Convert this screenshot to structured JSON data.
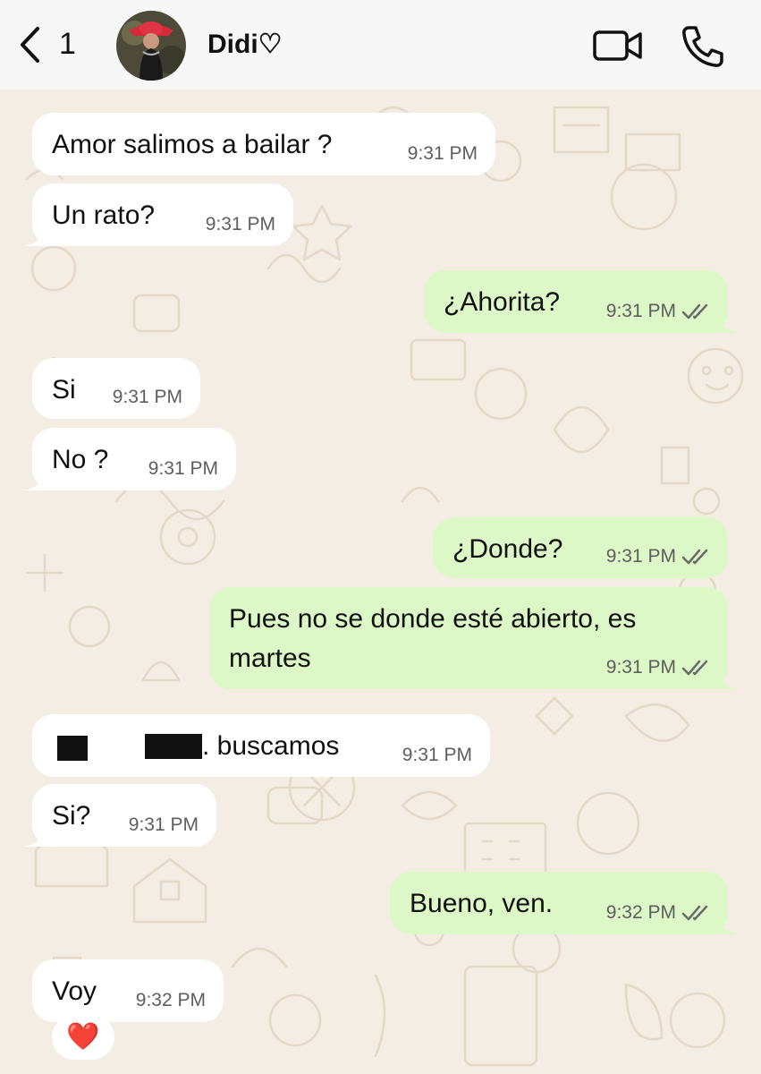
{
  "header": {
    "unread_count": "1",
    "contact_name": "Didi♡",
    "icons": [
      "back-chevron-icon",
      "video-camera-icon",
      "phone-icon"
    ]
  },
  "colors": {
    "incoming_bubble": "#ffffff",
    "outgoing_bubble": "#dcf8c6",
    "background": "#f3ede4",
    "read_ticks": "#6a6a6a"
  },
  "messages": [
    {
      "direction": "in",
      "text": "Amor salimos a bailar ?",
      "time": "9:31 PM"
    },
    {
      "direction": "in",
      "text": "Un rato?",
      "time": "9:31 PM"
    },
    {
      "direction": "out",
      "text": "¿Ahorita?",
      "time": "9:31 PM",
      "status": "read"
    },
    {
      "direction": "in",
      "text": "Si",
      "time": "9:31 PM"
    },
    {
      "direction": "in",
      "text": "No ?",
      "time": "9:31 PM"
    },
    {
      "direction": "out",
      "text": "¿Donde?",
      "time": "9:31 PM",
      "status": "read"
    },
    {
      "direction": "out",
      "text": "Pues no se donde esté abierto, es martes",
      "time": "9:31 PM",
      "status": "read"
    },
    {
      "direction": "in",
      "text": ". buscamos",
      "time": "9:31 PM",
      "redacted": true
    },
    {
      "direction": "in",
      "text": "Si?",
      "time": "9:31 PM"
    },
    {
      "direction": "out",
      "text": "Bueno, ven.",
      "time": "9:32 PM",
      "status": "read"
    },
    {
      "direction": "in",
      "text": "Voy",
      "time": "9:32 PM",
      "reaction": "❤️"
    }
  ]
}
